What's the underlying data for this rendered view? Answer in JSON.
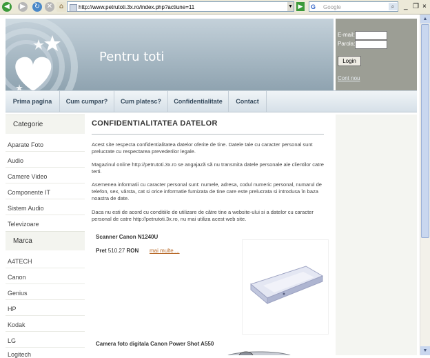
{
  "browser": {
    "url": "http://www.petrutoti.3x.ro/index.php?actiune=11",
    "search_placeholder": "Google",
    "google_logo": "G"
  },
  "header": {
    "site_title": "Pentru toti"
  },
  "login": {
    "email_label": "E-mail:",
    "password_label": "Parola:",
    "login_button": "Login",
    "new_account_link": "Cont nou"
  },
  "nav": {
    "items": [
      "Prima pagina",
      "Cum cumpar?",
      "Cum platesc?",
      "Confidentialitate",
      "Contact"
    ]
  },
  "sidebar": {
    "category_heading": "Categorie",
    "categories": [
      "Aparate Foto",
      "Audio",
      "Camere Video",
      "Componente IT",
      "Sistem Audio",
      "Televizoare"
    ],
    "brand_heading": "Marca",
    "brands": [
      "A4TECH",
      "Canon",
      "Genius",
      "HP",
      "Kodak",
      "LG",
      "Logitech"
    ]
  },
  "content": {
    "title": "CONFIDENTIALITATEA DATELOR",
    "paragraphs": [
      "Acest site respecta confidentialitatea datelor oferite de tine. Datele tale cu caracter personal sunt prelucrate cu respectarea prevederilor legale.",
      "Magazinul online http://petrutoti.3x.ro se angajază să nu transmita datele personale ale clientilor catre terti.",
      "Asemenea informatii cu caracter personal sunt: numele, adresa, codul numeric personal, numarul de telefon, sex, vârsta, cat si orice informatie furnizata de tine care este prelucrata si introdusa în baza noastra de date.",
      "Daca nu esti de acord cu conditiile de utilizare de către tine a website-ului si a datelor cu caracter personal de catre http://petrutoti.3x.ro, nu mai utiliza acest web site."
    ],
    "products": [
      {
        "name": "Scanner Canon N1240U",
        "price_label": "Pret",
        "price": "510.27",
        "currency": "RON",
        "more_link": "mai multe....",
        "image": "scanner"
      },
      {
        "name": "Camera foto digitala Canon Power Shot A550",
        "image": "camera"
      }
    ]
  },
  "colors": {
    "header_top": "#c4d1da",
    "header_bottom": "#8fa3b0",
    "login_bg": "#9c9e95",
    "nav_text": "#34495c",
    "link_orange": "#b86a2a"
  }
}
